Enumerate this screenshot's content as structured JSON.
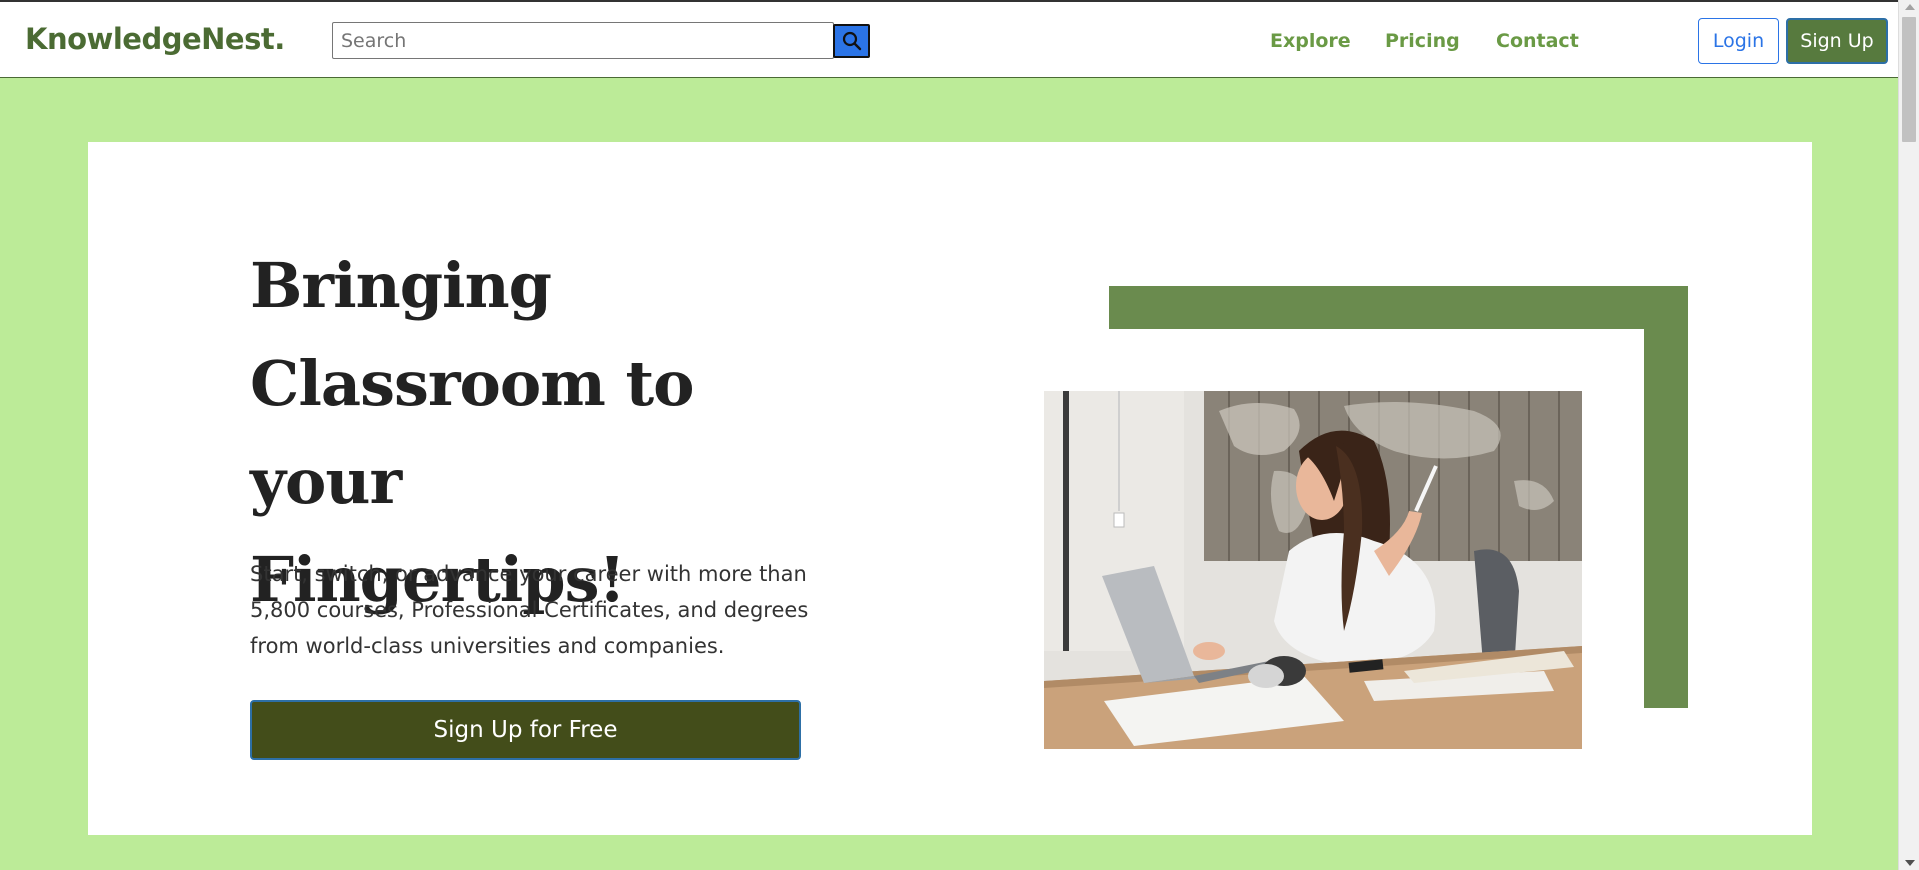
{
  "navbar": {
    "brand": "KnowledgeNest.",
    "search": {
      "placeholder": "Search",
      "value": ""
    },
    "links": [
      "Explore",
      "Pricing",
      "Contact"
    ],
    "login_label": "Login",
    "signup_label": "Sign Up"
  },
  "hero": {
    "title_lines": [
      "Bringing",
      "Classroom to your",
      "Fingertips!"
    ],
    "description_lines": [
      "Start, switch, or advance your career with more than",
      "5,800 courses, Professional Certificates, and degrees",
      "from world-class universities and companies."
    ],
    "cta_label": "Sign Up for Free"
  },
  "colors": {
    "page_background": "#bceb98",
    "brand": "#4b6b33",
    "nav_link": "#6a9a45",
    "login_border": "#2b74e6",
    "signup_bg": "#577a3e",
    "cta_bg": "#434d1a",
    "decoration": "#6a8b4e",
    "search_button": "#2b74e6"
  },
  "icons": {
    "search_button": "search-icon"
  }
}
